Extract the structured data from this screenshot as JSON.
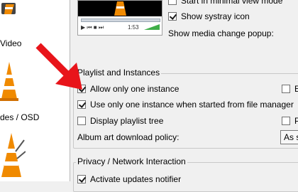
{
  "sidebar": {
    "labels": [
      {
        "text": "Video"
      },
      {
        "text": "des / OSD"
      }
    ]
  },
  "interface": {
    "top_options": [
      {
        "label": "Start in minimal view mode",
        "checked": false
      },
      {
        "label": "Show systray icon",
        "checked": true
      },
      {
        "label": "Show media change popup:"
      }
    ],
    "preview": {
      "time": "1:53",
      "controls": "▶ ⏮ ■ ⏭"
    }
  },
  "playlist_section": {
    "title": "Playlist and Instances",
    "options": [
      {
        "label": "Allow only one instance",
        "checked": true
      },
      {
        "label": "Use only one instance when started from file manager",
        "checked": true
      },
      {
        "label": "Display playlist tree",
        "checked": false
      }
    ],
    "side_options": [
      {
        "label": "E",
        "checked": false
      },
      {
        "label": "P",
        "checked": false
      }
    ],
    "album_art_label": "Album art download policy:",
    "album_art_value": "As s"
  },
  "privacy_section": {
    "title": "Privacy / Network Interaction",
    "options": [
      {
        "label": "Activate updates notifier",
        "checked": true
      }
    ]
  },
  "colors": {
    "arrow": "#e8141a",
    "cone_orange": "#f08a00"
  }
}
